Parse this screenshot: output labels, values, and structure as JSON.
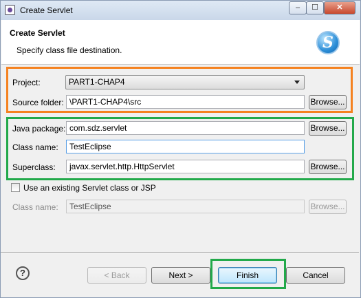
{
  "window": {
    "title": "Create Servlet",
    "controls": {
      "minimize": "–",
      "maximize": "☐",
      "close": "✕"
    }
  },
  "header": {
    "title": "Create Servlet",
    "subtitle": "Specify class file destination.",
    "logo_letter": "S"
  },
  "project": {
    "label": "Project:",
    "selected": "PART1-CHAP4"
  },
  "source_folder": {
    "label": "Source folder:",
    "value": "\\PART1-CHAP4\\src",
    "browse": "Browse..."
  },
  "java_package": {
    "label": "Java package:",
    "value": "com.sdz.servlet",
    "browse": "Browse..."
  },
  "class_name": {
    "label": "Class name:",
    "value": "TestEclipse"
  },
  "superclass": {
    "label": "Superclass:",
    "value": "javax.servlet.http.HttpServlet",
    "browse": "Browse..."
  },
  "existing": {
    "checkbox_label": "Use an existing Servlet class or JSP",
    "class_label": "Class name:",
    "class_value": "TestEclipse",
    "browse": "Browse..."
  },
  "footer": {
    "help": "?",
    "back": "< Back",
    "next": "Next >",
    "finish": "Finish",
    "cancel": "Cancel"
  },
  "colors": {
    "highlight_orange": "#f58220",
    "highlight_green": "#22a94a"
  }
}
